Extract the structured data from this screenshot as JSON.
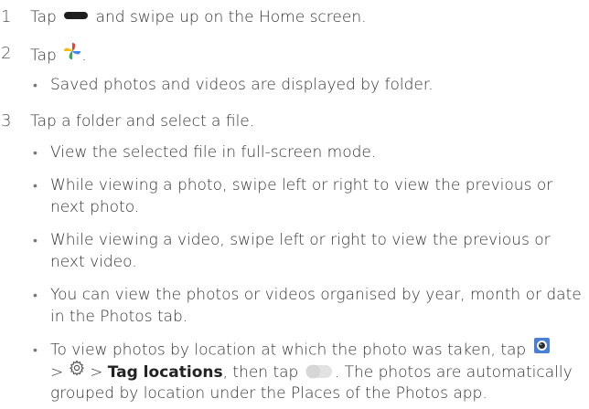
{
  "steps": [
    {
      "num": "1",
      "before": "Tap",
      "after": "and swipe up on the Home screen.",
      "icon": "home-pill-icon"
    },
    {
      "num": "2",
      "before": "Tap",
      "after": ".",
      "icon": "photos-pinwheel-icon"
    },
    {
      "num": "3",
      "text": "Tap a folder and select a file."
    }
  ],
  "bullets": {
    "b1": "Saved photos and videos are displayed by folder.",
    "b2": "View the selected file in full-screen mode.",
    "b3_l1": "While viewing a photo, swipe left or right to view the previous or",
    "b3_l2": "next photo.",
    "b4_l1": "While viewing a video, swipe left or right to view the previous or",
    "b4_l2": "next video.",
    "b5_l1": "You can view the photos or videos organised by year, month or date",
    "b5_l2": "in the Photos tab.",
    "b6_l1": "To view photos by location at which the photo was taken, tap",
    "b6_l2_gt1": ">",
    "b6_l2_gt2": ">",
    "b6_l2_bold": "Tag locations",
    "b6_l2_tail": ", then tap",
    "b6_l2_end": ". The photos are automatically",
    "b6_l3": "grouped by location under the Places of the Photos app."
  },
  "bullet_char": "•",
  "colors": {
    "text": "#333333",
    "camera_icon": "#4a7fd6",
    "pinwheel": [
      "#ea4335",
      "#fbbc05",
      "#34a853",
      "#4285f4"
    ]
  }
}
